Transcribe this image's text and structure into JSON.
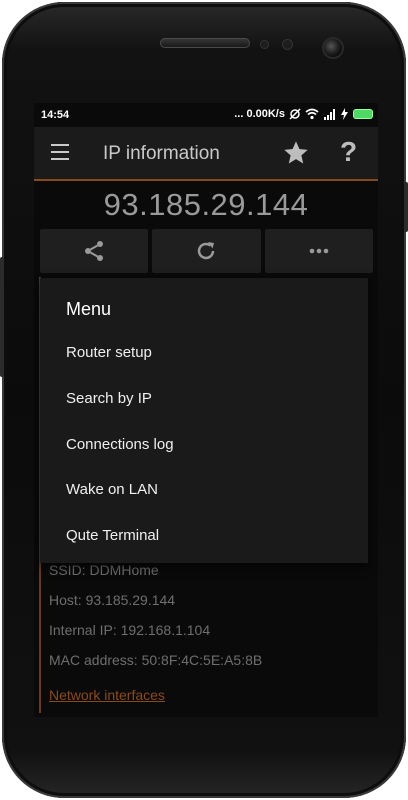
{
  "status_bar": {
    "time": "14:54",
    "speed": "... 0.00K/s",
    "icons": [
      "data-saver-icon",
      "wifi-icon",
      "signal-icon",
      "charging-icon",
      "battery-icon"
    ]
  },
  "app_bar": {
    "title": "IP information",
    "icons": [
      "hamburger-icon",
      "star-icon",
      "help-icon"
    ],
    "help_glyph": "?"
  },
  "ip": {
    "address": "93.185.29.144"
  },
  "actions": [
    {
      "name": "share",
      "icon": "share-icon"
    },
    {
      "name": "refresh",
      "icon": "refresh-icon"
    },
    {
      "name": "more",
      "icon": "more-icon"
    }
  ],
  "menu": {
    "title": "Menu",
    "items": [
      {
        "label": "Router setup"
      },
      {
        "label": "Search by IP"
      },
      {
        "label": "Connections log"
      },
      {
        "label": "Wake on LAN"
      },
      {
        "label": "Qute Terminal"
      }
    ]
  },
  "details": {
    "ssid": "SSID: DDMHome",
    "host": "Host: 93.185.29.144",
    "internal_ip": "Internal IP: 192.168.1.104",
    "mac": "MAC address: 50:8F:4C:5E:A5:8B",
    "network_link": "Network interfaces"
  },
  "colors": {
    "accent": "#8a4a18",
    "background": "#0a0a0a",
    "menu_background": "#1a1a1a",
    "text_dim": "#6e6e6e"
  }
}
